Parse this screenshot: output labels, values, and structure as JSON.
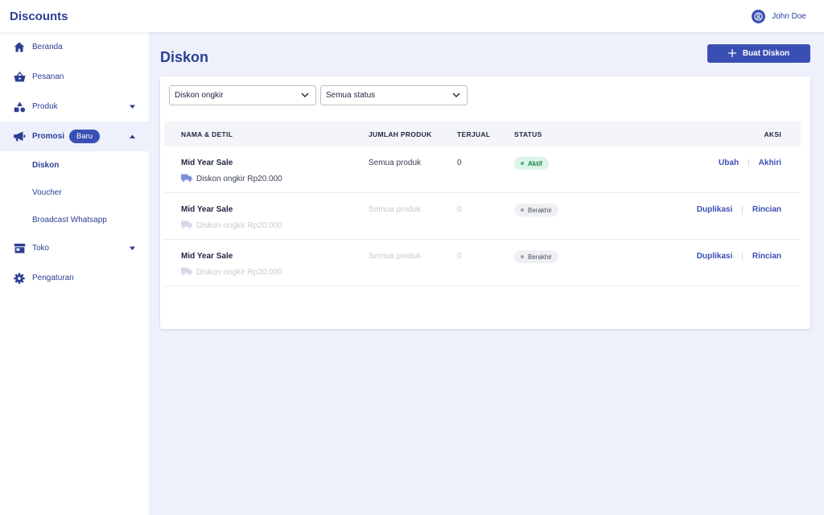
{
  "app": {
    "title": "Discounts"
  },
  "user": {
    "name": "John Doe",
    "icon": "user-circle-icon"
  },
  "sidebar": {
    "items": [
      {
        "label": "Beranda",
        "icon": "home-icon"
      },
      {
        "label": "Pesanan",
        "icon": "basket-icon"
      },
      {
        "label": "Produk",
        "icon": "shapes-icon"
      },
      {
        "label": "Promosi",
        "icon": "megaphone-icon",
        "badge": "Baru"
      },
      {
        "label": "Toko",
        "icon": "store-icon"
      },
      {
        "label": "Pengaturan",
        "icon": "gear-icon"
      }
    ],
    "promosi_sub": [
      {
        "label": "Diskon"
      },
      {
        "label": "Voucher"
      },
      {
        "label": "Broadcast Whatsapp"
      }
    ]
  },
  "page": {
    "title": "Diskon",
    "create_button": "Buat Diskon"
  },
  "filters": {
    "type": "Diskon ongkir",
    "status": "Semua status"
  },
  "table": {
    "headers": [
      "NAMA & DETIL",
      "JUMLAH PRODUK",
      "TERJUAL",
      "STATUS",
      "AKSI"
    ],
    "rows": [
      {
        "name": "Mid Year Sale",
        "detail": "Diskon ongkir Rp20.000",
        "products": "Semua produk",
        "sold": "0",
        "status": "Aktif",
        "actions": [
          "Ubah",
          "Akhiri"
        ]
      },
      {
        "name": "Mid Year Sale",
        "detail": "Diskon ongkir Rp20.000",
        "products": "Semua produk",
        "sold": "0",
        "status": "Berakhir",
        "actions": [
          "Duplikasi",
          "Rincian"
        ]
      },
      {
        "name": "Mid Year Sale",
        "detail": "Diskon ongkir Rp20.000",
        "products": "Semua produk",
        "sold": "0",
        "status": "Berakhir",
        "actions": [
          "Duplikasi",
          "Rincian"
        ]
      }
    ]
  },
  "colors": {
    "primary": "#3a4fb3",
    "background": "#eef1fb",
    "active_status": "#ddf5e7"
  }
}
